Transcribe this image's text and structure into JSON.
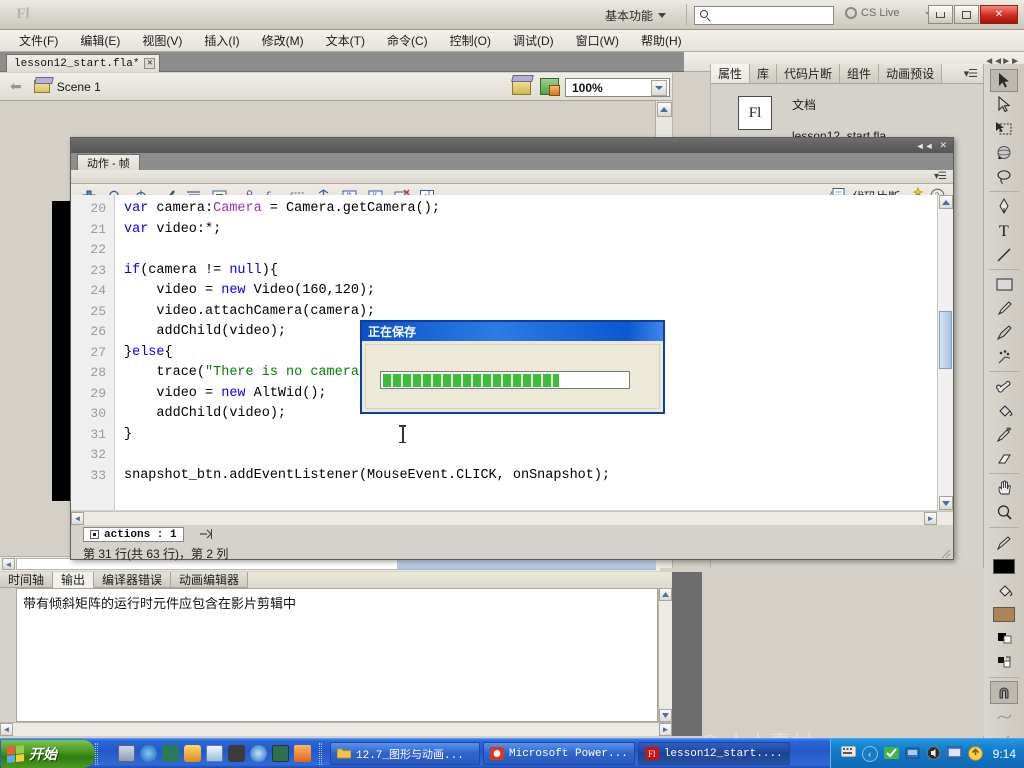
{
  "app": {
    "title_logo": "Fl",
    "workspace": "基本功能",
    "cs_live": "CS Live",
    "search_placeholder": "",
    "search_value": ""
  },
  "menubar": {
    "items": [
      "文件(F)",
      "编辑(E)",
      "视图(V)",
      "插入(I)",
      "修改(M)",
      "文本(T)",
      "命令(C)",
      "控制(O)",
      "调试(D)",
      "窗口(W)",
      "帮助(H)"
    ]
  },
  "document_tab": {
    "label": "lesson12_start.fla*",
    "close": "✕"
  },
  "editbar": {
    "scene": "Scene 1",
    "zoom": "100%"
  },
  "properties_panel": {
    "tabs": [
      "属性",
      "库",
      "代码片断",
      "组件",
      "动画预设"
    ],
    "active_tab": "属性",
    "doc_thumb": "Fl",
    "doc_type": "文档",
    "doc_name": "lesson12_start.fla"
  },
  "actions_panel": {
    "tab": "动作 - 帧",
    "snippets_label": "代码片断",
    "script_chip": "actions : 1",
    "line_status": "第 31 行(共 63 行)，第 2 列",
    "toolbar_icons": [
      "add-item-icon",
      "find-icon",
      "insert-target-path-icon",
      "check-syntax-icon",
      "auto-format-icon",
      "show-code-hint-icon",
      "debug-options-icon",
      "collapse-between-braces-icon",
      "collapse-selection-icon",
      "expand-all-icon",
      "apply-block-comment-icon",
      "apply-line-comment-icon",
      "remove-comment-icon",
      "show-hide-toolbox-icon"
    ],
    "code_lines": [
      {
        "n": "20",
        "tokens": [
          {
            "t": "var ",
            "c": "kw"
          },
          {
            "t": "camera:",
            "c": "pl"
          },
          {
            "t": "Camera",
            "c": "kw2"
          },
          {
            "t": " = Camera.getCamera();",
            "c": "pl"
          }
        ]
      },
      {
        "n": "21",
        "tokens": [
          {
            "t": "var ",
            "c": "kw"
          },
          {
            "t": "video:*;",
            "c": "pl"
          }
        ]
      },
      {
        "n": "22",
        "tokens": [
          {
            "t": "",
            "c": "pl"
          }
        ]
      },
      {
        "n": "23",
        "tokens": [
          {
            "t": "if",
            "c": "kw"
          },
          {
            "t": "(camera != ",
            "c": "pl"
          },
          {
            "t": "null",
            "c": "kw"
          },
          {
            "t": "){",
            "c": "pl"
          }
        ]
      },
      {
        "n": "24",
        "tokens": [
          {
            "t": "    video = ",
            "c": "pl"
          },
          {
            "t": "new ",
            "c": "kw"
          },
          {
            "t": "Video",
            "c": "pl"
          },
          {
            "t": "(160,120);",
            "c": "pl"
          }
        ]
      },
      {
        "n": "25",
        "tokens": [
          {
            "t": "    video.attachCamera(camera);",
            "c": "pl"
          }
        ]
      },
      {
        "n": "26",
        "tokens": [
          {
            "t": "    addChild(video);",
            "c": "pl"
          }
        ]
      },
      {
        "n": "27",
        "tokens": [
          {
            "t": "}",
            "c": "pl"
          },
          {
            "t": "else",
            "c": "kw"
          },
          {
            "t": "{",
            "c": "pl"
          }
        ]
      },
      {
        "n": "28",
        "tokens": [
          {
            "t": "    trace(",
            "c": "pl"
          },
          {
            "t": "\"There is no camera attached to this computer.\"",
            "c": "str"
          },
          {
            "t": ");",
            "c": "pl"
          }
        ]
      },
      {
        "n": "29",
        "tokens": [
          {
            "t": "    video = ",
            "c": "pl"
          },
          {
            "t": "new ",
            "c": "kw"
          },
          {
            "t": "AltWid();",
            "c": "pl"
          }
        ]
      },
      {
        "n": "30",
        "tokens": [
          {
            "t": "    addChild(video);",
            "c": "pl"
          }
        ]
      },
      {
        "n": "31",
        "tokens": [
          {
            "t": "}",
            "c": "pl"
          }
        ]
      },
      {
        "n": "32",
        "tokens": [
          {
            "t": "",
            "c": "pl"
          }
        ]
      },
      {
        "n": "33",
        "tokens": [
          {
            "t": "snapshot_btn.addEventListener(MouseEvent.CLICK, onSnapshot);",
            "c": "pl"
          }
        ]
      }
    ]
  },
  "save_dialog": {
    "title": "正在保存",
    "progress_percent": 72,
    "segment_count": 26
  },
  "output_panel": {
    "tabs": [
      "时间轴",
      "输出",
      "编译器错误",
      "动画编辑器"
    ],
    "active_tab": "输出",
    "message": "带有倾斜矩阵的运行时元件应包含在影片剪辑中"
  },
  "toolbar": {
    "tools": [
      "selection-tool",
      "subselection-tool",
      "free-transform-tool",
      "3d-rotation-tool",
      "lasso-tool",
      "pen-tool",
      "text-tool",
      "line-tool",
      "rectangle-tool",
      "pencil-tool",
      "brush-tool",
      "deco-tool",
      "bone-tool",
      "paint-bucket-tool",
      "eyedropper-tool",
      "eraser-tool",
      "hand-tool",
      "zoom-tool",
      "stroke-color",
      "fill-color-black",
      "fill-bucket-swatch",
      "fill-color-tan",
      "black-and-white",
      "swap-colors",
      "snap-to-objects",
      "smooth-option",
      "straighten-option"
    ]
  },
  "taskbar": {
    "start_label": "开始",
    "quicklaunch": [
      "show-desktop-icon",
      "media-player-icon",
      "sogou-icon",
      "paint-icon",
      "notepad-icon",
      "flash-player-icon",
      "ie-icon",
      "calculator-icon",
      "outlook-icon"
    ],
    "tasks": [
      {
        "label": "12.7_图形与动画...",
        "icon": "folder-icon",
        "active": false
      },
      {
        "label": "Microsoft Power...",
        "icon": "powerpoint-icon",
        "active": false
      },
      {
        "label": "lesson12_start....",
        "icon": "flash-icon",
        "active": true
      }
    ],
    "tray_icons": [
      "keyboard-icon",
      "volume-icon",
      "network-icon",
      "screen-icon",
      "antivirus-icon",
      "update-icon"
    ],
    "clock": "9:14"
  },
  "watermark": "人人素材",
  "colors": {
    "accent_blue": "#0b3fa8",
    "progress_green": "#3bbf3b",
    "taskbar_blue": "#2558c6",
    "start_green": "#47951f",
    "code_blue": "#0000b0",
    "string_green": "#008000"
  }
}
